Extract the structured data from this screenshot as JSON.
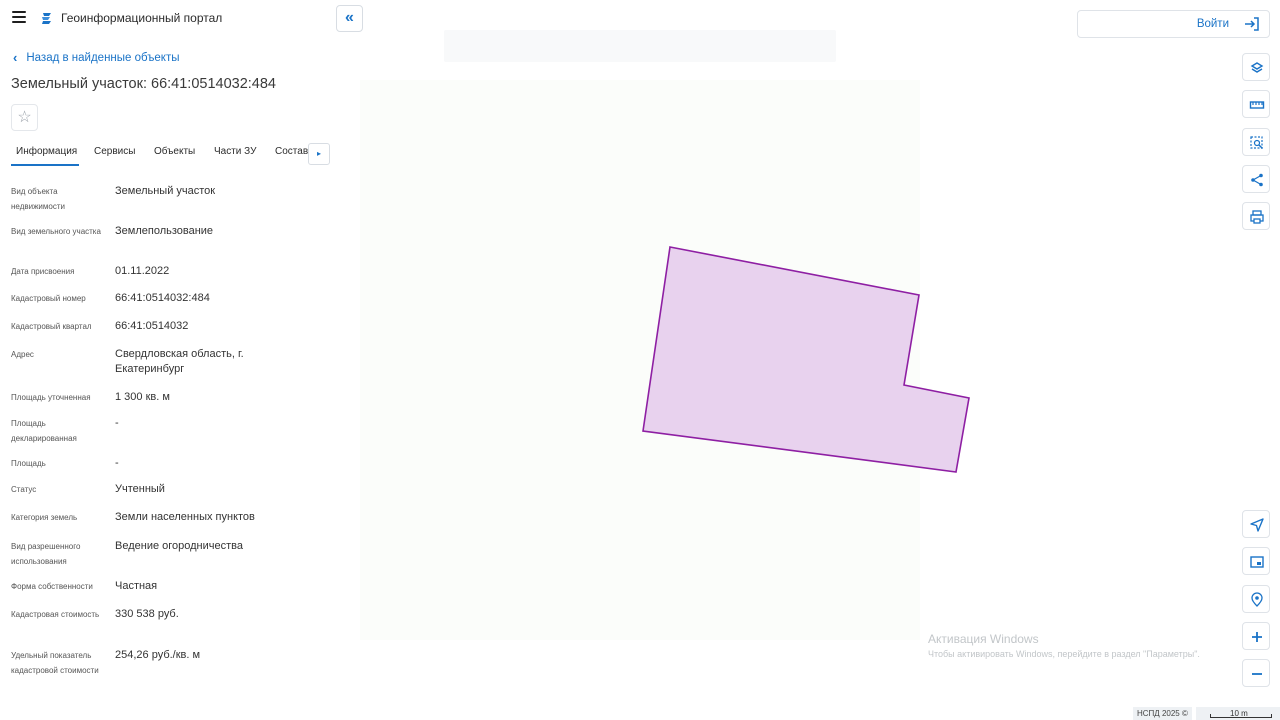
{
  "header": {
    "portal_title": "Геоинформационный портал",
    "collapse_symbol": "«"
  },
  "nav": {
    "back_label": "Назад в найденные объекты",
    "back_symbol": "‹"
  },
  "object": {
    "title": "Земельный участок: 66:41:0514032:484",
    "favorite_symbol": "☆"
  },
  "tabs": [
    {
      "label": "Информация",
      "active": true
    },
    {
      "label": "Сервисы"
    },
    {
      "label": "Объекты"
    },
    {
      "label": "Части ЗУ"
    },
    {
      "label": "Состав"
    }
  ],
  "tabs_more_symbol": "▸",
  "properties": [
    {
      "label": "Вид объекта недвижимости",
      "value": "Земельный участок"
    },
    {
      "label": "Вид земельного участка",
      "value": "Землепользование"
    },
    {
      "label": "Дата присвоения",
      "value": "01.11.2022"
    },
    {
      "label": "Кадастровый номер",
      "value": "66:41:0514032:484"
    },
    {
      "label": "Кадастровый квартал",
      "value": "66:41:0514032"
    },
    {
      "label": "Адрес",
      "value": "Свердловская область, г. Екатеринбург"
    },
    {
      "label": "Площадь уточненная",
      "value": "1 300 кв. м"
    },
    {
      "label": "Площадь декларированная",
      "value": "-"
    },
    {
      "label": "Площадь",
      "value": "-"
    },
    {
      "label": "Статус",
      "value": "Учтенный"
    },
    {
      "label": "Категория земель",
      "value": "Земли населенных пунктов"
    },
    {
      "label": "Вид разрешенного использования",
      "value": "Ведение огородничества"
    },
    {
      "label": "Форма собственности",
      "value": "Частная"
    },
    {
      "label": "Кадастровая стоимость",
      "value": "330 538 руб."
    },
    {
      "label": "Удельный показатель кадастровой стоимости",
      "value": "254,26 руб./кв. м"
    }
  ],
  "login": {
    "label": "Войти"
  },
  "tools_top": [
    "layers-icon",
    "ruler-icon",
    "area-select-icon",
    "share-icon",
    "print-icon"
  ],
  "tools_bottom": [
    "locate-icon",
    "minimap-icon",
    "geolocation-icon",
    "zoom-in-icon",
    "zoom-out-icon"
  ],
  "watermark": {
    "line1": "Активация Windows",
    "line2": "Чтобы активировать Windows, перейдите в раздел \"Параметры\"."
  },
  "footer": {
    "credit": "НСПД 2025 ©",
    "scale_label": "10 m"
  },
  "colors": {
    "accent": "#1a73c7",
    "parcel_fill": "#e8d2ee",
    "parcel_stroke": "#8e1fa3"
  }
}
